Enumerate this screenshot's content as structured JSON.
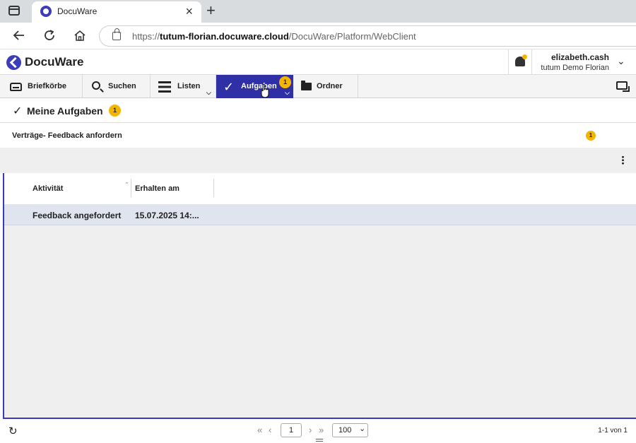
{
  "browser": {
    "tab_title": "DocuWare",
    "tab_close": "×",
    "new_tab": "+",
    "url_prefix": "https://",
    "url_host": "tutum-florian.docuware.cloud",
    "url_path": "/DocuWare/Platform/WebClient"
  },
  "app": {
    "logo_text": "DocuWare",
    "user_name": "elizabeth.cash",
    "user_org": "tutum Demo Florian"
  },
  "nav": {
    "items": [
      {
        "label": "Briefkörbe"
      },
      {
        "label": "Suchen"
      },
      {
        "label": "Listen"
      },
      {
        "label": "Aufgaben",
        "badge": "1"
      },
      {
        "label": "Ordner"
      }
    ]
  },
  "page": {
    "title": "Meine Aufgaben",
    "title_badge": "1",
    "group_label": "Verträge- Feedback anfordern",
    "group_badge": "1"
  },
  "list": {
    "columns": [
      "Aktivität",
      "Erhalten am"
    ],
    "rows": [
      {
        "activity": "Feedback angefordert",
        "received": "15.07.2025 14:..."
      }
    ]
  },
  "footer": {
    "current_page": "1",
    "page_size": "100",
    "count": "1-1 von 1"
  },
  "colors": {
    "brand": "#3b3dba",
    "active_nav": "#2f2fa6",
    "badge": "#f5b400"
  }
}
